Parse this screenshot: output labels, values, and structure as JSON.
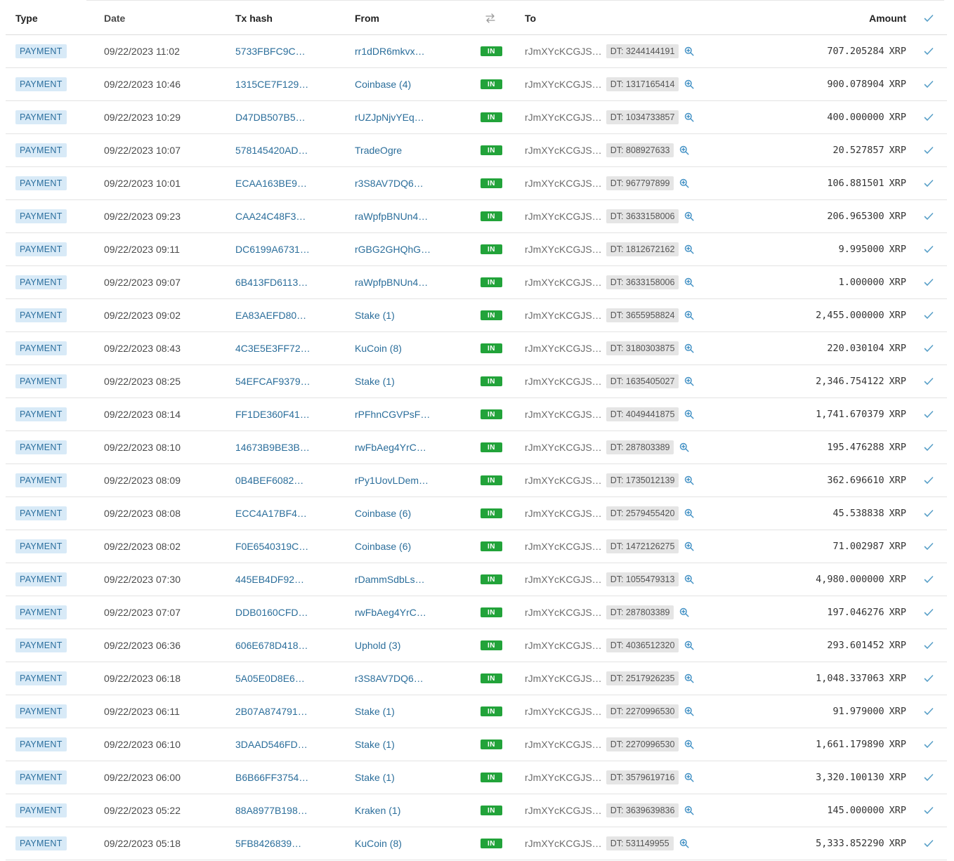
{
  "headers": {
    "type": "Type",
    "date": "Date",
    "hash": "Tx hash",
    "from": "From",
    "to": "To",
    "amount": "Amount"
  },
  "icons": {
    "direction_header": "swap-arrows-icon",
    "check": "check-icon",
    "zoom": "magnifier-plus-icon"
  },
  "colors": {
    "link": "#2b6e9b",
    "in_badge": "#22a33a",
    "type_badge_bg": "#d8eaf7",
    "check": "#5aa0c8"
  },
  "unit": "XRP",
  "rows": [
    {
      "type": "PAYMENT",
      "date": "09/22/2023 11:02",
      "hash": "5733FBFC9C…",
      "from": "rr1dDR6mkvx…",
      "dir": "IN",
      "to": "rJmXYcKCGJS…",
      "dt": "DT: 3244144191",
      "amount": "707.205284"
    },
    {
      "type": "PAYMENT",
      "date": "09/22/2023 10:46",
      "hash": "1315CE7F129…",
      "from": "Coinbase (4)",
      "dir": "IN",
      "to": "rJmXYcKCGJS…",
      "dt": "DT: 1317165414",
      "amount": "900.078904"
    },
    {
      "type": "PAYMENT",
      "date": "09/22/2023 10:29",
      "hash": "D47DB507B5…",
      "from": "rUZJpNjvYEq…",
      "dir": "IN",
      "to": "rJmXYcKCGJS…",
      "dt": "DT: 1034733857",
      "amount": "400.000000"
    },
    {
      "type": "PAYMENT",
      "date": "09/22/2023 10:07",
      "hash": "578145420AD…",
      "from": "TradeOgre",
      "dir": "IN",
      "to": "rJmXYcKCGJS…",
      "dt": "DT: 808927633",
      "amount": "20.527857"
    },
    {
      "type": "PAYMENT",
      "date": "09/22/2023 10:01",
      "hash": "ECAA163BE9…",
      "from": "r3S8AV7DQ6…",
      "dir": "IN",
      "to": "rJmXYcKCGJS…",
      "dt": "DT: 967797899",
      "amount": "106.881501"
    },
    {
      "type": "PAYMENT",
      "date": "09/22/2023 09:23",
      "hash": "CAA24C48F3…",
      "from": "raWpfpBNUn4…",
      "dir": "IN",
      "to": "rJmXYcKCGJS…",
      "dt": "DT: 3633158006",
      "amount": "206.965300"
    },
    {
      "type": "PAYMENT",
      "date": "09/22/2023 09:11",
      "hash": "DC6199A6731…",
      "from": "rGBG2GHQhG…",
      "dir": "IN",
      "to": "rJmXYcKCGJS…",
      "dt": "DT: 1812672162",
      "amount": "9.995000"
    },
    {
      "type": "PAYMENT",
      "date": "09/22/2023 09:07",
      "hash": "6B413FD6113…",
      "from": "raWpfpBNUn4…",
      "dir": "IN",
      "to": "rJmXYcKCGJS…",
      "dt": "DT: 3633158006",
      "amount": "1.000000"
    },
    {
      "type": "PAYMENT",
      "date": "09/22/2023 09:02",
      "hash": "EA83AEFD80…",
      "from": "Stake (1)",
      "dir": "IN",
      "to": "rJmXYcKCGJS…",
      "dt": "DT: 3655958824",
      "amount": "2,455.000000"
    },
    {
      "type": "PAYMENT",
      "date": "09/22/2023 08:43",
      "hash": "4C3E5E3FF72…",
      "from": "KuCoin (8)",
      "dir": "IN",
      "to": "rJmXYcKCGJS…",
      "dt": "DT: 3180303875",
      "amount": "220.030104"
    },
    {
      "type": "PAYMENT",
      "date": "09/22/2023 08:25",
      "hash": "54EFCAF9379…",
      "from": "Stake (1)",
      "dir": "IN",
      "to": "rJmXYcKCGJS…",
      "dt": "DT: 1635405027",
      "amount": "2,346.754122"
    },
    {
      "type": "PAYMENT",
      "date": "09/22/2023 08:14",
      "hash": "FF1DE360F41…",
      "from": "rPFhnCGVPsF…",
      "dir": "IN",
      "to": "rJmXYcKCGJS…",
      "dt": "DT: 4049441875",
      "amount": "1,741.670379"
    },
    {
      "type": "PAYMENT",
      "date": "09/22/2023 08:10",
      "hash": "14673B9BE3B…",
      "from": "rwFbAeg4YrC…",
      "dir": "IN",
      "to": "rJmXYcKCGJS…",
      "dt": "DT: 287803389",
      "amount": "195.476288"
    },
    {
      "type": "PAYMENT",
      "date": "09/22/2023 08:09",
      "hash": "0B4BEF6082…",
      "from": "rPy1UovLDem…",
      "dir": "IN",
      "to": "rJmXYcKCGJS…",
      "dt": "DT: 1735012139",
      "amount": "362.696610"
    },
    {
      "type": "PAYMENT",
      "date": "09/22/2023 08:08",
      "hash": "ECC4A17BF4…",
      "from": "Coinbase (6)",
      "dir": "IN",
      "to": "rJmXYcKCGJS…",
      "dt": "DT: 2579455420",
      "amount": "45.538838"
    },
    {
      "type": "PAYMENT",
      "date": "09/22/2023 08:02",
      "hash": "F0E6540319C…",
      "from": "Coinbase (6)",
      "dir": "IN",
      "to": "rJmXYcKCGJS…",
      "dt": "DT: 1472126275",
      "amount": "71.002987"
    },
    {
      "type": "PAYMENT",
      "date": "09/22/2023 07:30",
      "hash": "445EB4DF92…",
      "from": "rDammSdbLs…",
      "dir": "IN",
      "to": "rJmXYcKCGJS…",
      "dt": "DT: 1055479313",
      "amount": "4,980.000000"
    },
    {
      "type": "PAYMENT",
      "date": "09/22/2023 07:07",
      "hash": "DDB0160CFD…",
      "from": "rwFbAeg4YrC…",
      "dir": "IN",
      "to": "rJmXYcKCGJS…",
      "dt": "DT: 287803389",
      "amount": "197.046276"
    },
    {
      "type": "PAYMENT",
      "date": "09/22/2023 06:36",
      "hash": "606E678D418…",
      "from": "Uphold (3)",
      "dir": "IN",
      "to": "rJmXYcKCGJS…",
      "dt": "DT: 4036512320",
      "amount": "293.601452"
    },
    {
      "type": "PAYMENT",
      "date": "09/22/2023 06:18",
      "hash": "5A05E0D8E6…",
      "from": "r3S8AV7DQ6…",
      "dir": "IN",
      "to": "rJmXYcKCGJS…",
      "dt": "DT: 2517926235",
      "amount": "1,048.337063"
    },
    {
      "type": "PAYMENT",
      "date": "09/22/2023 06:11",
      "hash": "2B07A874791…",
      "from": "Stake (1)",
      "dir": "IN",
      "to": "rJmXYcKCGJS…",
      "dt": "DT: 2270996530",
      "amount": "91.979000"
    },
    {
      "type": "PAYMENT",
      "date": "09/22/2023 06:10",
      "hash": "3DAAD546FD…",
      "from": "Stake (1)",
      "dir": "IN",
      "to": "rJmXYcKCGJS…",
      "dt": "DT: 2270996530",
      "amount": "1,661.179890"
    },
    {
      "type": "PAYMENT",
      "date": "09/22/2023 06:00",
      "hash": "B6B66FF3754…",
      "from": "Stake (1)",
      "dir": "IN",
      "to": "rJmXYcKCGJS…",
      "dt": "DT: 3579619716",
      "amount": "3,320.100130"
    },
    {
      "type": "PAYMENT",
      "date": "09/22/2023 05:22",
      "hash": "88A8977B198…",
      "from": "Kraken (1)",
      "dir": "IN",
      "to": "rJmXYcKCGJS…",
      "dt": "DT: 3639639836",
      "amount": "145.000000"
    },
    {
      "type": "PAYMENT",
      "date": "09/22/2023 05:18",
      "hash": "5FB8426839…",
      "from": "KuCoin (8)",
      "dir": "IN",
      "to": "rJmXYcKCGJS…",
      "dt": "DT: 531149955",
      "amount": "5,333.852290"
    }
  ]
}
